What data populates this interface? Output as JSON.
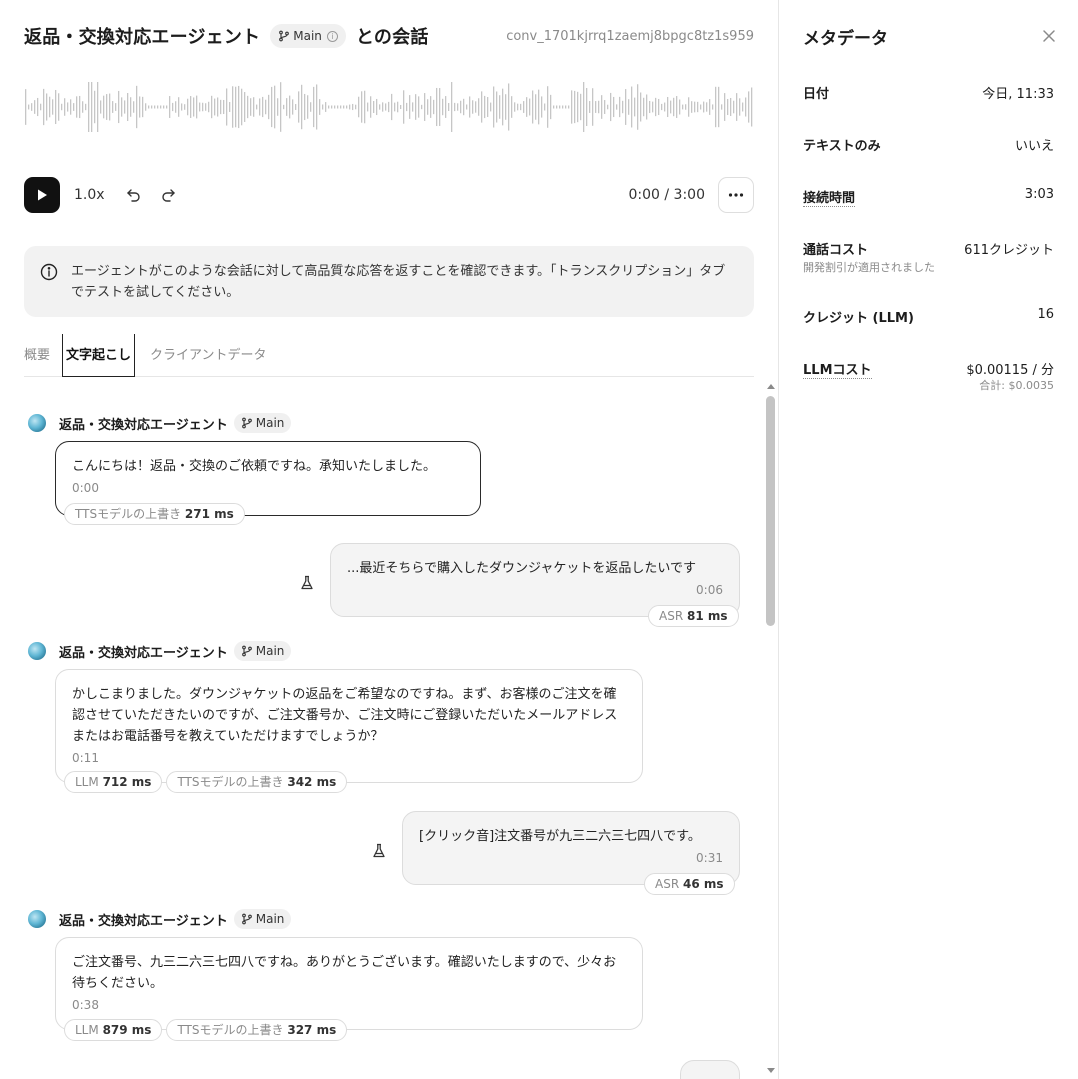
{
  "header": {
    "title_prefix": "返品・交換対応エージェント",
    "branch": "Main",
    "title_suffix": "との会話",
    "conversation_id": "conv_1701kjrrq1zaemj8bpgc8tz1s959"
  },
  "player": {
    "speed": "1.0x",
    "time": "0:00 / 3:00"
  },
  "notice": {
    "text": "エージェントがこのような会話に対して高品質な応答を返すことを確認できます。「トランスクリプション」タブでテストを試してください。"
  },
  "tabs": [
    {
      "label": "概要"
    },
    {
      "label": "文字起こし",
      "active": true
    },
    {
      "label": "クライアントデータ"
    }
  ],
  "transcript": {
    "agent_name": "返品・交換対応エージェント",
    "branch": "Main",
    "messages": [
      {
        "role": "agent",
        "text": "こんにちは！返品・交換のご依頼ですね。承知いたしました。",
        "time": "0:00",
        "metrics": [
          {
            "label": "TTSモデルの上書き",
            "value": "271 ms"
          }
        ]
      },
      {
        "role": "user",
        "text": "...最近そちらで購入したダウンジャケットを返品したいです",
        "time": "0:06",
        "metrics": [
          {
            "label": "ASR",
            "value": "81 ms"
          }
        ]
      },
      {
        "role": "agent",
        "text": "かしこまりました。ダウンジャケットの返品をご希望なのですね。まず、お客様のご注文を確認させていただきたいのですが、ご注文番号か、ご注文時にご登録いただいたメールアドレスまたはお電話番号を教えていただけますでしょうか？",
        "time": "0:11",
        "metrics": [
          {
            "label": "LLM",
            "value": "712 ms"
          },
          {
            "label": "TTSモデルの上書き",
            "value": "342 ms"
          }
        ]
      },
      {
        "role": "user",
        "text": "[クリック音]注文番号が九三二六三七四八です。",
        "time": "0:31",
        "metrics": [
          {
            "label": "ASR",
            "value": "46 ms"
          }
        ]
      },
      {
        "role": "agent",
        "text": "ご注文番号、九三二六三七四八ですね。ありがとうございます。確認いたしますので、少々お待ちください。",
        "time": "0:38",
        "metrics": [
          {
            "label": "LLM",
            "value": "879 ms"
          },
          {
            "label": "TTSモデルの上書き",
            "value": "327 ms"
          }
        ]
      }
    ]
  },
  "metadata": {
    "title": "メタデータ",
    "rows": [
      {
        "label": "日付",
        "value": "今日, 11:33"
      },
      {
        "label": "テキストのみ",
        "value": "いいえ"
      },
      {
        "label": "接続時間",
        "value": "3:03"
      },
      {
        "label": "通話コスト",
        "value": "611クレジット",
        "sub": "開発割引が適用されました"
      },
      {
        "label": "クレジット (LLM)",
        "value": "16"
      },
      {
        "label": "LLMコスト",
        "value": "$0.00115 / 分",
        "subvalue": "合計: $0.0035"
      }
    ]
  },
  "icons": {
    "branch": "git-branch-icon",
    "play": "play-icon",
    "rewind": "rewind-icon",
    "forward": "forward-icon",
    "more": "more-horizontal-icon",
    "info": "info-icon",
    "user": "user-flask-icon",
    "close": "close-icon"
  },
  "colors": {
    "accent": "#111111",
    "notice_bg": "#f2f2f2",
    "muted": "#8a8a8a"
  }
}
